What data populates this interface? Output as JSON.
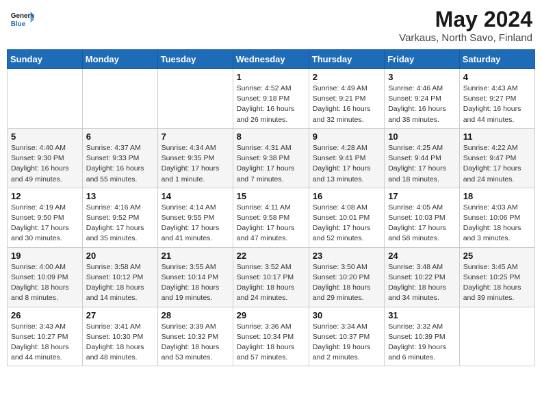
{
  "header": {
    "logo_general": "General",
    "logo_blue": "Blue",
    "month_year": "May 2024",
    "location": "Varkaus, North Savo, Finland"
  },
  "days_of_week": [
    "Sunday",
    "Monday",
    "Tuesday",
    "Wednesday",
    "Thursday",
    "Friday",
    "Saturday"
  ],
  "weeks": [
    [
      {
        "day": "",
        "info": ""
      },
      {
        "day": "",
        "info": ""
      },
      {
        "day": "",
        "info": ""
      },
      {
        "day": "1",
        "info": "Sunrise: 4:52 AM\nSunset: 9:18 PM\nDaylight: 16 hours\nand 26 minutes."
      },
      {
        "day": "2",
        "info": "Sunrise: 4:49 AM\nSunset: 9:21 PM\nDaylight: 16 hours\nand 32 minutes."
      },
      {
        "day": "3",
        "info": "Sunrise: 4:46 AM\nSunset: 9:24 PM\nDaylight: 16 hours\nand 38 minutes."
      },
      {
        "day": "4",
        "info": "Sunrise: 4:43 AM\nSunset: 9:27 PM\nDaylight: 16 hours\nand 44 minutes."
      }
    ],
    [
      {
        "day": "5",
        "info": "Sunrise: 4:40 AM\nSunset: 9:30 PM\nDaylight: 16 hours\nand 49 minutes."
      },
      {
        "day": "6",
        "info": "Sunrise: 4:37 AM\nSunset: 9:33 PM\nDaylight: 16 hours\nand 55 minutes."
      },
      {
        "day": "7",
        "info": "Sunrise: 4:34 AM\nSunset: 9:35 PM\nDaylight: 17 hours\nand 1 minute."
      },
      {
        "day": "8",
        "info": "Sunrise: 4:31 AM\nSunset: 9:38 PM\nDaylight: 17 hours\nand 7 minutes."
      },
      {
        "day": "9",
        "info": "Sunrise: 4:28 AM\nSunset: 9:41 PM\nDaylight: 17 hours\nand 13 minutes."
      },
      {
        "day": "10",
        "info": "Sunrise: 4:25 AM\nSunset: 9:44 PM\nDaylight: 17 hours\nand 18 minutes."
      },
      {
        "day": "11",
        "info": "Sunrise: 4:22 AM\nSunset: 9:47 PM\nDaylight: 17 hours\nand 24 minutes."
      }
    ],
    [
      {
        "day": "12",
        "info": "Sunrise: 4:19 AM\nSunset: 9:50 PM\nDaylight: 17 hours\nand 30 minutes."
      },
      {
        "day": "13",
        "info": "Sunrise: 4:16 AM\nSunset: 9:52 PM\nDaylight: 17 hours\nand 35 minutes."
      },
      {
        "day": "14",
        "info": "Sunrise: 4:14 AM\nSunset: 9:55 PM\nDaylight: 17 hours\nand 41 minutes."
      },
      {
        "day": "15",
        "info": "Sunrise: 4:11 AM\nSunset: 9:58 PM\nDaylight: 17 hours\nand 47 minutes."
      },
      {
        "day": "16",
        "info": "Sunrise: 4:08 AM\nSunset: 10:01 PM\nDaylight: 17 hours\nand 52 minutes."
      },
      {
        "day": "17",
        "info": "Sunrise: 4:05 AM\nSunset: 10:03 PM\nDaylight: 17 hours\nand 58 minutes."
      },
      {
        "day": "18",
        "info": "Sunrise: 4:03 AM\nSunset: 10:06 PM\nDaylight: 18 hours\nand 3 minutes."
      }
    ],
    [
      {
        "day": "19",
        "info": "Sunrise: 4:00 AM\nSunset: 10:09 PM\nDaylight: 18 hours\nand 8 minutes."
      },
      {
        "day": "20",
        "info": "Sunrise: 3:58 AM\nSunset: 10:12 PM\nDaylight: 18 hours\nand 14 minutes."
      },
      {
        "day": "21",
        "info": "Sunrise: 3:55 AM\nSunset: 10:14 PM\nDaylight: 18 hours\nand 19 minutes."
      },
      {
        "day": "22",
        "info": "Sunrise: 3:52 AM\nSunset: 10:17 PM\nDaylight: 18 hours\nand 24 minutes."
      },
      {
        "day": "23",
        "info": "Sunrise: 3:50 AM\nSunset: 10:20 PM\nDaylight: 18 hours\nand 29 minutes."
      },
      {
        "day": "24",
        "info": "Sunrise: 3:48 AM\nSunset: 10:22 PM\nDaylight: 18 hours\nand 34 minutes."
      },
      {
        "day": "25",
        "info": "Sunrise: 3:45 AM\nSunset: 10:25 PM\nDaylight: 18 hours\nand 39 minutes."
      }
    ],
    [
      {
        "day": "26",
        "info": "Sunrise: 3:43 AM\nSunset: 10:27 PM\nDaylight: 18 hours\nand 44 minutes."
      },
      {
        "day": "27",
        "info": "Sunrise: 3:41 AM\nSunset: 10:30 PM\nDaylight: 18 hours\nand 48 minutes."
      },
      {
        "day": "28",
        "info": "Sunrise: 3:39 AM\nSunset: 10:32 PM\nDaylight: 18 hours\nand 53 minutes."
      },
      {
        "day": "29",
        "info": "Sunrise: 3:36 AM\nSunset: 10:34 PM\nDaylight: 18 hours\nand 57 minutes."
      },
      {
        "day": "30",
        "info": "Sunrise: 3:34 AM\nSunset: 10:37 PM\nDaylight: 19 hours\nand 2 minutes."
      },
      {
        "day": "31",
        "info": "Sunrise: 3:32 AM\nSunset: 10:39 PM\nDaylight: 19 hours\nand 6 minutes."
      },
      {
        "day": "",
        "info": ""
      }
    ]
  ]
}
